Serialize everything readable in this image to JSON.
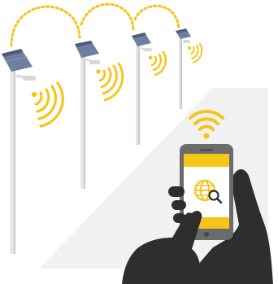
{
  "illustration": {
    "subject": "smart-street-lights-controlled-by-phone",
    "colors": {
      "signal": "#F5C518",
      "pole": "#E6E6E6",
      "pole_shadow": "#C9C9C9",
      "panel": "#6E7FA0",
      "panel_dark": "#4E5C7A",
      "lamp": "#D8D8D8",
      "beam": "#F1F1F1",
      "phone_body": "#6B6B6B",
      "phone_screen_band": "#F5C518",
      "phone_screen": "#FFFFFF",
      "hand": "#2E2E2E"
    },
    "poles": [
      {
        "name": "street-light-pole-1"
      },
      {
        "name": "street-light-pole-2"
      },
      {
        "name": "street-light-pole-3"
      },
      {
        "name": "street-light-pole-4"
      }
    ],
    "phone": {
      "screen_icon": "globe-search-icon",
      "signal_icon": "wifi-icon"
    }
  }
}
